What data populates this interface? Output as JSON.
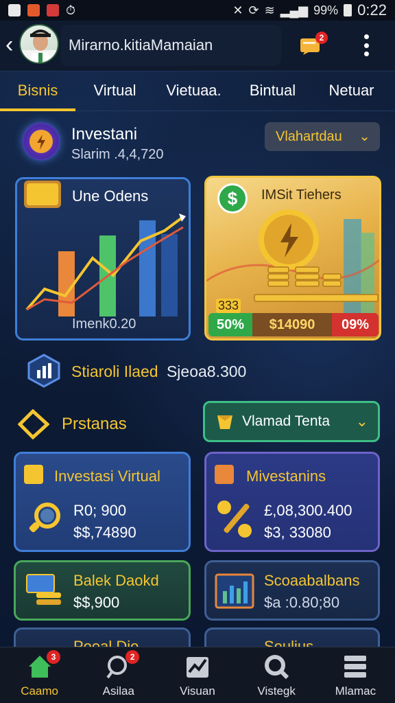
{
  "status_bar": {
    "battery": "99%",
    "time": "0:22"
  },
  "header": {
    "name": "Mirarno.kitiaMamaian",
    "message_badge": "2"
  },
  "tabs": [
    {
      "label": "Bisnis",
      "active": true
    },
    {
      "label": "Virtual",
      "active": false
    },
    {
      "label": "Vietuaa.",
      "active": false
    },
    {
      "label": "Bintual",
      "active": false
    },
    {
      "label": "Netuar",
      "active": false
    }
  ],
  "investment": {
    "title": "Investani",
    "subtitle": "Slarim .4,4,720",
    "dropdown_label": "Vlahartdau"
  },
  "card_left": {
    "title": "Une Odens",
    "footer": "Imenk0.20"
  },
  "card_right": {
    "title": "IMSit Tiehers",
    "coin_label": "333",
    "badge_left": "50%",
    "badge_mid": "$14090",
    "badge_right": "09%"
  },
  "stats": {
    "label": "Stiaroli Ilaed",
    "value": "Sjeoa8.300"
  },
  "section": {
    "title": "Prstanas",
    "dropdown_label": "Vlamad Tenta"
  },
  "cards": [
    {
      "title": "Investasi Virtual",
      "value1": "R0; 900",
      "value2": "$$,74890"
    },
    {
      "title": "Mivestanins",
      "value1": "£,08,300.400",
      "value2": "$3, 33080"
    },
    {
      "title": "Balek Daokd",
      "value1": "$$,900"
    },
    {
      "title": "Scoaabalbans",
      "value1": "$a :0.80;80"
    },
    {
      "title": "Poeal Dio"
    },
    {
      "title": "Seulius"
    }
  ],
  "bottom_nav": [
    {
      "label": "Caamo",
      "badge": "3"
    },
    {
      "label": "Asilaa",
      "badge": "2"
    },
    {
      "label": "Visuan",
      "badge": ""
    },
    {
      "label": "Vistegk",
      "badge": ""
    },
    {
      "label": "Mlamac",
      "badge": ""
    }
  ],
  "colors": {
    "accent": "#f5c531",
    "green": "#2fa84a",
    "red": "#d3322e",
    "blue_border": "#3f7fd8"
  }
}
